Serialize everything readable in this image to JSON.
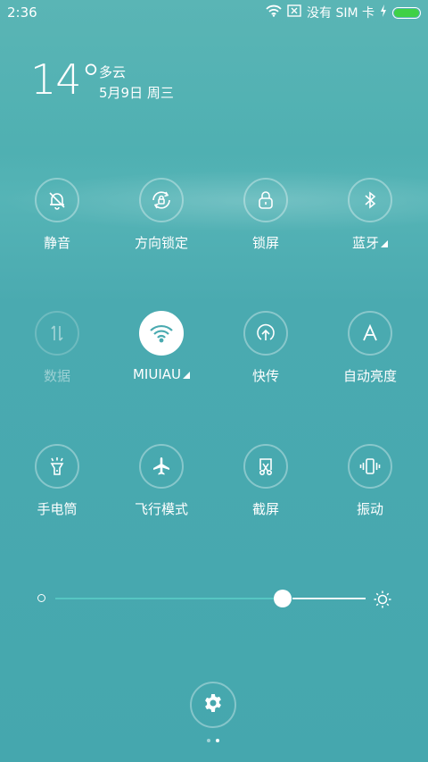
{
  "status": {
    "time": "2:36",
    "sim": "没有 SIM 卡",
    "battery_color": "#3fd146"
  },
  "weather": {
    "temp": "14°",
    "condition": "多云",
    "date": "5月9日 周三"
  },
  "toggles": [
    {
      "label": "静音",
      "icon": "bell-off-icon"
    },
    {
      "label": "方向锁定",
      "icon": "rotation-lock-icon"
    },
    {
      "label": "锁屏",
      "icon": "lock-icon"
    },
    {
      "label": "蓝牙",
      "icon": "bluetooth-icon"
    },
    {
      "label": "数据",
      "icon": "mobile-data-icon"
    },
    {
      "label": "MIUIAU",
      "icon": "wifi-icon"
    },
    {
      "label": "快传",
      "icon": "share-upload-icon"
    },
    {
      "label": "自动亮度",
      "icon": "auto-brightness-icon"
    },
    {
      "label": "手电筒",
      "icon": "flashlight-icon"
    },
    {
      "label": "飞行模式",
      "icon": "airplane-icon"
    },
    {
      "label": "截屏",
      "icon": "screenshot-icon"
    },
    {
      "label": "振动",
      "icon": "vibrate-icon"
    }
  ],
  "brightness": {
    "level": 0.7
  }
}
